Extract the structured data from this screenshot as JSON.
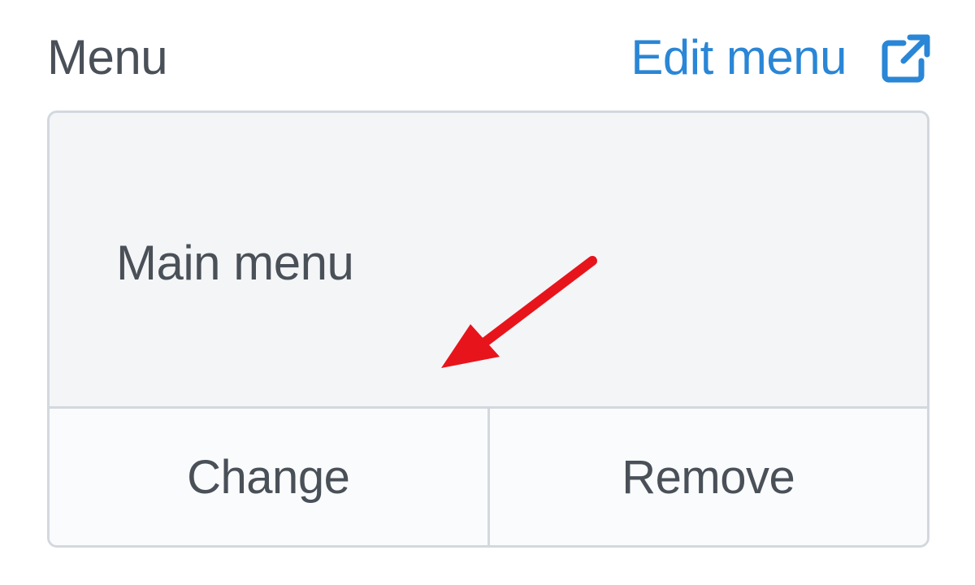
{
  "section": {
    "label": "Menu",
    "edit_link": {
      "label": "Edit menu",
      "icon": "external-link-icon"
    }
  },
  "selector": {
    "selected_menu": "Main menu",
    "actions": {
      "change_label": "Change",
      "remove_label": "Remove"
    }
  },
  "annotation": {
    "icon": "arrow-icon",
    "color": "#e8141b"
  },
  "colors": {
    "accent": "#2a86d6",
    "text": "#4a5058",
    "border": "#d3d8de",
    "panel": "#f4f5f7"
  }
}
